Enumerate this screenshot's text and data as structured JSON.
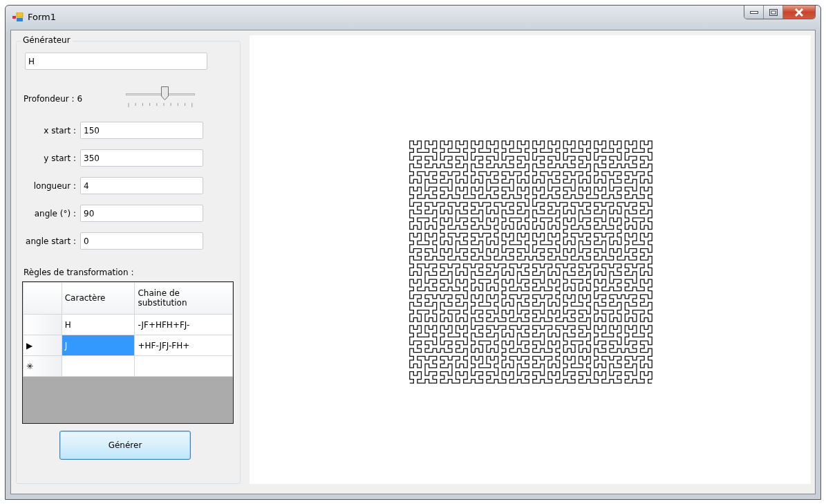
{
  "window": {
    "title": "Form1"
  },
  "generator": {
    "legend": "Générateur",
    "axiom": "H"
  },
  "depth": {
    "label": "Profondeur : 6",
    "level": 0.56
  },
  "fields": [
    {
      "label": "x start :",
      "value": "150"
    },
    {
      "label": "y start :",
      "value": "350"
    },
    {
      "label": "longueur :",
      "value": "4"
    },
    {
      "label": "angle (°) :",
      "value": "90"
    },
    {
      "label": "angle start :",
      "value": "0"
    }
  ],
  "rules": {
    "label": "Règles de transformation :",
    "columns": [
      "Caractère",
      "Chaine de substitution"
    ],
    "rows": [
      {
        "marker": "",
        "cells": [
          {
            "text": "H",
            "selected": false
          },
          {
            "text": "-JF+HFH+FJ-",
            "selected": false
          }
        ]
      },
      {
        "marker": "▶",
        "cells": [
          {
            "text": "J",
            "selected": true
          },
          {
            "text": "+HF-JFJ-FH+",
            "selected": false
          }
        ]
      },
      {
        "marker": "✳",
        "cells": [
          {
            "text": "",
            "selected": false
          },
          {
            "text": "",
            "selected": false
          }
        ]
      }
    ]
  },
  "button": "Générer"
}
